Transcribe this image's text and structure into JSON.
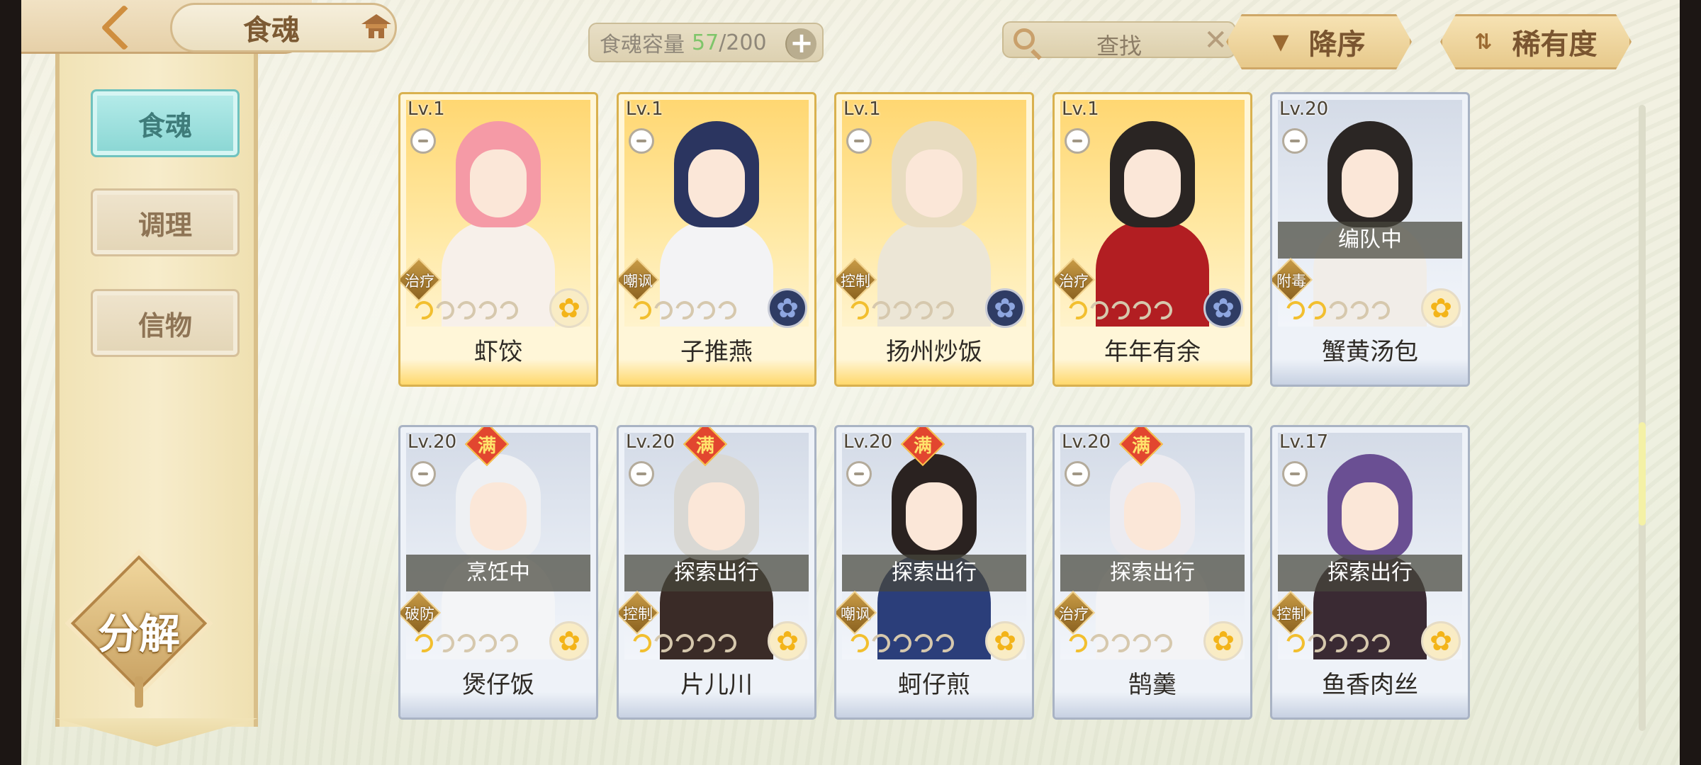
{
  "header": {
    "title": "食魂",
    "capacity_label": "食魂容量",
    "capacity_current": "57",
    "capacity_max": "/200",
    "search_placeholder": "查找",
    "sort_order_label": "降序",
    "sort_rarity_label": "稀有度"
  },
  "sidebar": {
    "items": [
      {
        "label": "食魂",
        "active": true
      },
      {
        "label": "调理",
        "active": false
      },
      {
        "label": "信物",
        "active": false
      }
    ],
    "decompose_label": "分解"
  },
  "cards": [
    {
      "level": "Lv.1",
      "name": "虾饺",
      "role": "治疗",
      "full": false,
      "status": "",
      "stars_on": 1,
      "element": "flower-gold",
      "frame": "gold",
      "hair": "#f59aa6",
      "outfit": "#f7f0ea"
    },
    {
      "level": "Lv.1",
      "name": "子推燕",
      "role": "嘲讽",
      "full": false,
      "status": "",
      "stars_on": 1,
      "element": "flower-blue",
      "frame": "gold",
      "hair": "#2b3560",
      "outfit": "#f3f3f5"
    },
    {
      "level": "Lv.1",
      "name": "扬州炒饭",
      "role": "控制",
      "full": false,
      "status": "",
      "stars_on": 1,
      "element": "flower-blue",
      "frame": "gold",
      "hair": "#e8dcc0",
      "outfit": "#ece6d6"
    },
    {
      "level": "Lv.1",
      "name": "年年有余",
      "role": "治疗",
      "full": false,
      "status": "",
      "stars_on": 1,
      "element": "flower-blue",
      "frame": "gold",
      "hair": "#2a2523",
      "outfit": "#b21e22"
    },
    {
      "level": "Lv.20",
      "name": "蟹黄汤包",
      "role": "附毒",
      "full": false,
      "status": "编队中",
      "stars_on": 2,
      "element": "flower-gold",
      "frame": "silver",
      "hair": "#2b2624",
      "outfit": "#f1ede8"
    },
    {
      "level": "Lv.20",
      "name": "煲仔饭",
      "role": "破防",
      "full": true,
      "status": "烹饪中",
      "stars_on": 1,
      "element": "flower-gold",
      "frame": "silver",
      "hair": "#eef0f3",
      "outfit": "#f4f5f7"
    },
    {
      "level": "Lv.20",
      "name": "片儿川",
      "role": "控制",
      "full": true,
      "status": "探索出行",
      "stars_on": 1,
      "element": "flower-gold",
      "frame": "silver",
      "hair": "#d9d8d4",
      "outfit": "#3a2b27"
    },
    {
      "level": "Lv.20",
      "name": "蚵仔煎",
      "role": "嘲讽",
      "full": true,
      "status": "探索出行",
      "stars_on": 1,
      "element": "flower-gold",
      "frame": "silver",
      "hair": "#2a2220",
      "outfit": "#2b3e7a"
    },
    {
      "level": "Lv.20",
      "name": "鹄羹",
      "role": "治疗",
      "full": true,
      "status": "探索出行",
      "stars_on": 1,
      "element": "flower-gold",
      "frame": "silver",
      "hair": "#ecebf0",
      "outfit": "#f4f4f6"
    },
    {
      "level": "Lv.17",
      "name": "鱼香肉丝",
      "role": "控制",
      "full": false,
      "status": "探索出行",
      "stars_on": 1,
      "element": "flower-gold",
      "frame": "silver",
      "hair": "#6a4f93",
      "outfit": "#3a2a33"
    }
  ],
  "full_badge_text": "满"
}
